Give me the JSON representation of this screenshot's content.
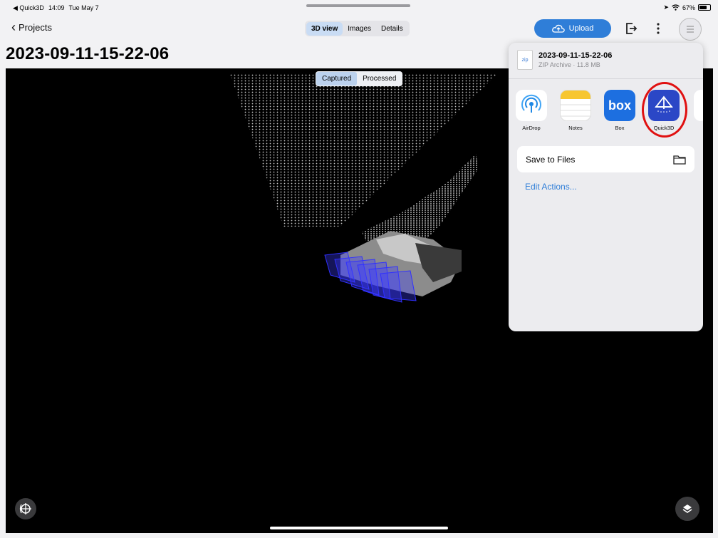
{
  "status_bar": {
    "back_app": "◀ Quick3D",
    "time": "14:09",
    "date": "Tue May 7",
    "battery": "67%"
  },
  "nav": {
    "back_label": "Projects",
    "tabs": [
      {
        "label": "3D view",
        "active": true
      },
      {
        "label": "Images",
        "active": false
      },
      {
        "label": "Details",
        "active": false
      }
    ],
    "upload_label": "Upload"
  },
  "page": {
    "title": "2023-09-11-15-22-06"
  },
  "viewer": {
    "mode_tabs": [
      {
        "label": "Captured",
        "active": true
      },
      {
        "label": "Processed",
        "active": false
      }
    ]
  },
  "share_sheet": {
    "file_icon_text": "zip",
    "file_name": "2023-09-11-15-22-06",
    "file_meta": "ZIP Archive · 11.8 MB",
    "apps": [
      {
        "label": "AirDrop",
        "icon": "airdrop-icon"
      },
      {
        "label": "Notes",
        "icon": "notes-icon"
      },
      {
        "label": "Box",
        "icon": "box-icon",
        "icon_text": "box"
      },
      {
        "label": "Quick3D",
        "icon": "quick3d-icon"
      }
    ],
    "save_to_files": "Save to Files",
    "edit_actions": "Edit Actions..."
  },
  "colors": {
    "accent": "#2f7ed8",
    "highlight": "#e01010"
  }
}
